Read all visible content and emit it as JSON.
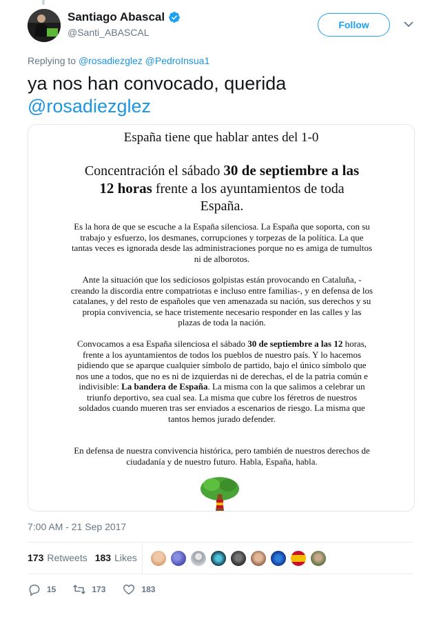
{
  "user": {
    "name": "Santiago Abascal",
    "handle": "@Santi_ABASCAL",
    "follow_label": "Follow"
  },
  "reply": {
    "prefix": "Replying to",
    "mentions": [
      "@rosadiezglez",
      "@PedroInsua1"
    ]
  },
  "tweet": {
    "text": "ya nos han convocado, querida",
    "link": "@rosadiezglez"
  },
  "document": {
    "title": "España tiene que hablar antes del 1-0",
    "headline_a": "Concentración el sábado ",
    "headline_b": "30 de septiembre a las 12 horas",
    "headline_c": " frente a los ayuntamientos de toda España.",
    "p1": "Es la hora de que se escuche a la España silenciosa. La España que soporta, con su trabajo y esfuerzo, los desmanes, corrupciones y torpezas de la política. La que tantas veces es ignorada desde las administraciones porque no es amiga de tumultos ni de alborotos.",
    "p2": "Ante la situación que los sediciosos golpistas están provocando en Cataluña, -creando la discordia entre compatriotas e incluso entre familias-, y en defensa de los catalanes, y del resto de españoles que ven amenazada su nación, sus derechos y su propia convivencia, se hace tristemente necesario responder en las calles y las plazas de toda la nación.",
    "p3_a": "Convocamos a esa España silenciosa el sábado ",
    "p3_b": "30 de septiembre a las 12",
    "p3_c": " horas, frente a los ayuntamientos de todos los pueblos de nuestro país. Y lo hacemos pidiendo que se aparque cualquier símbolo de partido,  bajo el único símbolo que nos une a todos, que no es ni de izquierdas ni de derechas, el de la patria común e indivisible: ",
    "p3_d": "La bandera de España",
    "p3_e": ". La misma con la que salimos a celebrar un triunfo deportivo, sea cual sea. La misma que cubre los féretros de nuestros soldados cuando mueren tras ser enviados a escenarios de riesgo. La misma que tantos hemos jurado defender.",
    "p4": "En defensa de nuestra convivencia histórica, pero también de nuestros derechos de ciudadanía y de nuestro futuro. Habla, España, habla."
  },
  "timestamp": "7:00 AM - 21 Sep 2017",
  "stats": {
    "retweets_count": "173",
    "retweets_label": "Retweets",
    "likes_count": "183",
    "likes_label": "Likes"
  },
  "actions": {
    "replies": "15",
    "retweets": "173",
    "likes": "183"
  },
  "colors": {
    "accent": "#1da1f2",
    "link": "#1b95e0",
    "muted": "#657786"
  }
}
